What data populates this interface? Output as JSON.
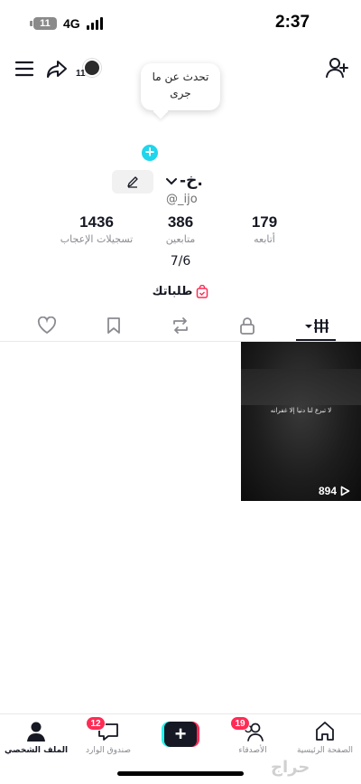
{
  "status_bar": {
    "battery": "11",
    "network": "4G",
    "time": "2:37"
  },
  "header": {
    "notification_count": "11",
    "status_bubble": "تحدث عن ما جرى"
  },
  "profile": {
    "display_name": "-خ.",
    "username": "@_ijo",
    "stats": {
      "likes": {
        "value": "1436",
        "label": "تسجيلات الإعجاب"
      },
      "followers": {
        "value": "386",
        "label": "متابعين"
      },
      "following": {
        "value": "179",
        "label": "أتابعه"
      }
    },
    "bio": "7/6",
    "orders_label": "طلباتك"
  },
  "videos": [
    {
      "caption": "لا تبرع لنا دنيا إلا غفرانه",
      "views": "894"
    }
  ],
  "bottom_nav": {
    "home": "الصفحة الرئيسية",
    "friends": "الأصدقاء",
    "friends_badge": "19",
    "inbox": "صندوق الوارد",
    "inbox_badge": "12",
    "profile": "الملف الشخصي"
  },
  "watermark": "حراج",
  "colors": {
    "accent": "#fe2c55",
    "cyan": "#25f4ee",
    "plus_blue": "#20d5ec",
    "text": "#161823"
  },
  "icons": [
    "menu-icon",
    "share-icon",
    "add-friend-icon",
    "edit-icon",
    "chevron-down-icon",
    "shopping-bag-icon",
    "grid-icon",
    "lock-icon",
    "repost-icon",
    "bookmark-icon",
    "heart-icon",
    "play-icon",
    "home-icon",
    "friends-icon",
    "inbox-icon",
    "profile-icon"
  ]
}
